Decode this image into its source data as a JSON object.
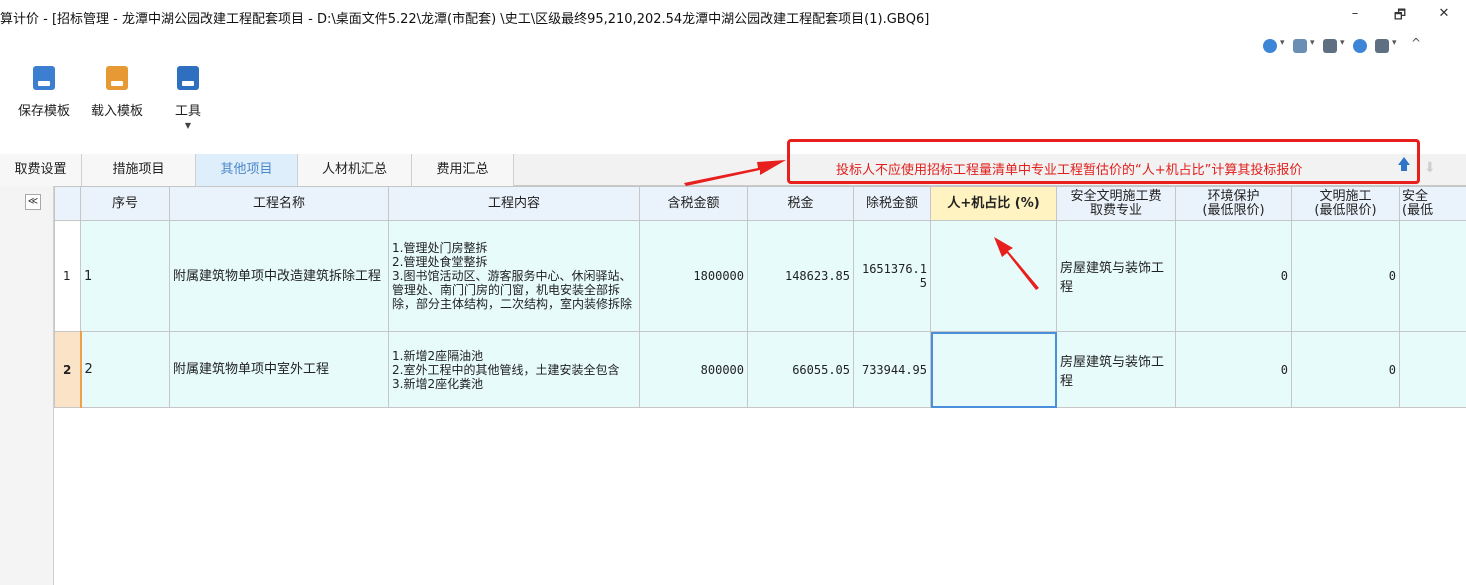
{
  "window": {
    "title": "算计价 - [招标管理 - 龙潭中湖公园改建工程配套项目 - D:\\桌面文件5.22\\龙潭(市配套) \\史工\\区级最终95,210,202.54龙潭中湖公园改建工程配套项目(1).GBQ6]",
    "min": "–",
    "max": "🗗",
    "close": "✕"
  },
  "toolbar": {
    "save_label": "保存模板",
    "load_label": "载入模板",
    "tools_label": "工具",
    "caret": "▼"
  },
  "help_strip": {
    "up_caret": "^"
  },
  "tabs": [
    "取费设置",
    "措施项目",
    "其他项目",
    "人材机汇总",
    "费用汇总"
  ],
  "active_tab": "其他项目",
  "annotation": {
    "text": "投标人不应使用招标工程量清单中专业工程暂估价的“人+机占比”计算其投标报价",
    "color": "#e8201d"
  },
  "gutter": {
    "collapse": "≪"
  },
  "grid": {
    "headers": {
      "seq": "序号",
      "name": "工程名称",
      "content": "工程内容",
      "tax_incl": "含税金额",
      "tax": "税金",
      "tax_excl": "除税金额",
      "labor_ratio": "人+机占比 (%)",
      "safety_fee": "安全文明施工费\n取费专业",
      "env": "环境保护\n(最低限价)",
      "civil": "文明施工\n(最低限价)",
      "safety_cut": "安全\n(最低"
    },
    "rows": [
      {
        "rownum": "1",
        "seq": "1",
        "name": "附属建筑物单项中改造建筑拆除工程",
        "content": "1.管理处门房整拆\n2.管理处食堂整拆\n3.图书馆活动区、游客服务中心、休闲驿站、管理处、南门门房的门窗，机电安装全部拆除，部分主体结构，二次结构，室内装修拆除",
        "tax_incl": "1800000",
        "tax": "148623.85",
        "tax_excl": "1651376.15",
        "labor_ratio": "",
        "safety_fee": "房屋建筑与装饰工程",
        "env": "0",
        "civil": "0"
      },
      {
        "rownum": "2",
        "seq": "2",
        "name": "附属建筑物单项中室外工程",
        "content": "1.新增2座隔油池\n2.室外工程中的其他管线，土建安装全包含\n3.新增2座化粪池",
        "tax_incl": "800000",
        "tax": "66055.05",
        "tax_excl": "733944.95",
        "labor_ratio": "",
        "safety_fee": "房屋建筑与装饰工程",
        "env": "0",
        "civil": "0"
      }
    ]
  }
}
